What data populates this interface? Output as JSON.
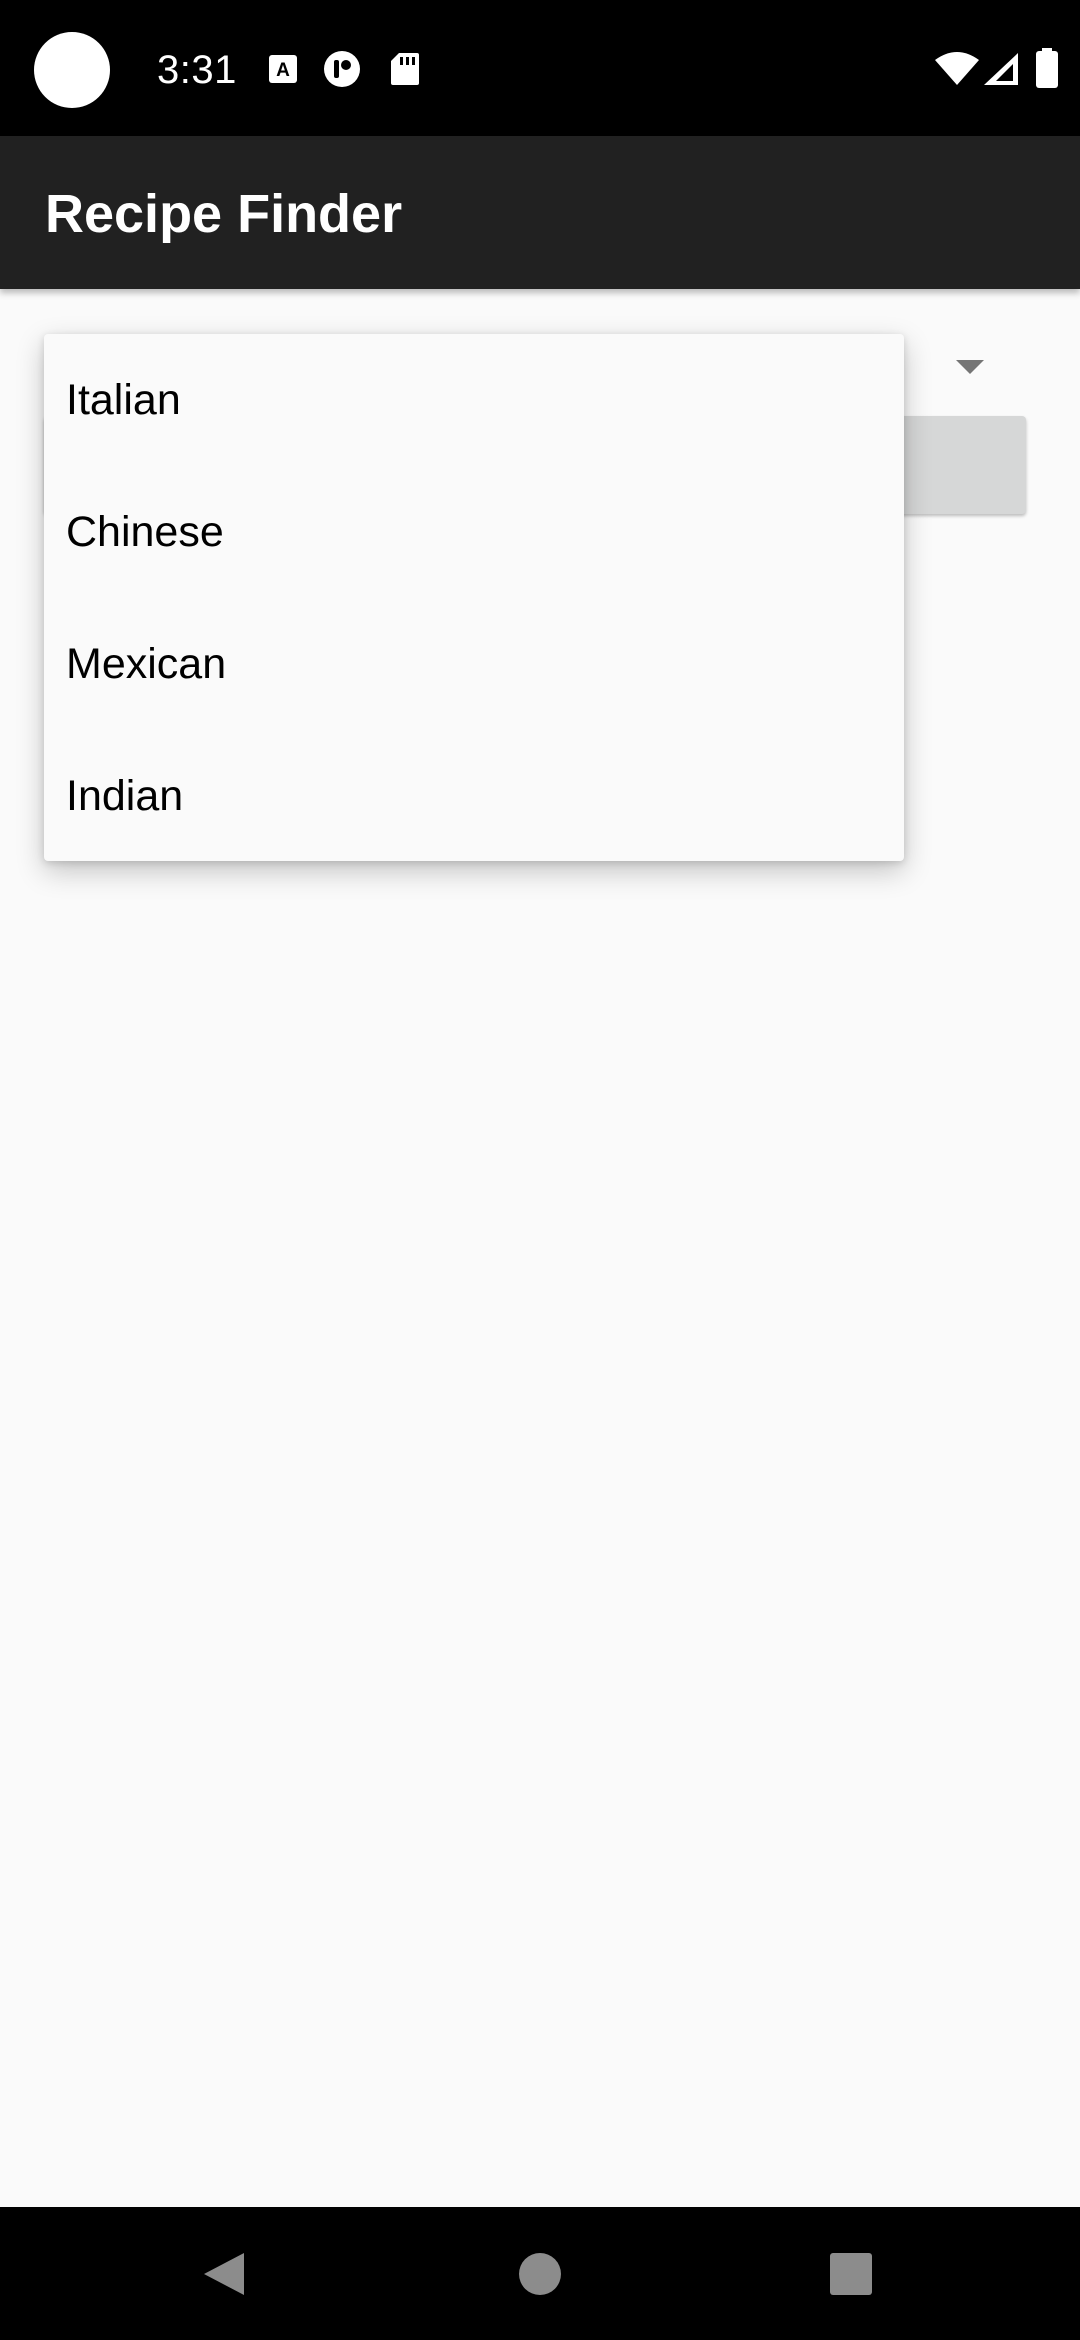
{
  "status_bar": {
    "time": "3:31",
    "icons": [
      "notification-a-icon",
      "notification-circle-icon",
      "sd-card-icon",
      "wifi-icon",
      "signal-icon",
      "battery-icon"
    ]
  },
  "app_bar": {
    "title": "Recipe Finder"
  },
  "spinner": {
    "options": [
      {
        "label": "Italian"
      },
      {
        "label": "Chinese"
      },
      {
        "label": "Mexican"
      },
      {
        "label": "Indian"
      }
    ]
  },
  "nav_bar": {
    "buttons": [
      "back-icon",
      "home-icon",
      "recents-icon"
    ]
  },
  "colors": {
    "app_bar_bg": "#212121",
    "content_bg": "#fafafa",
    "button_bg": "#d6d7d7",
    "status_bar_bg": "#000000"
  }
}
